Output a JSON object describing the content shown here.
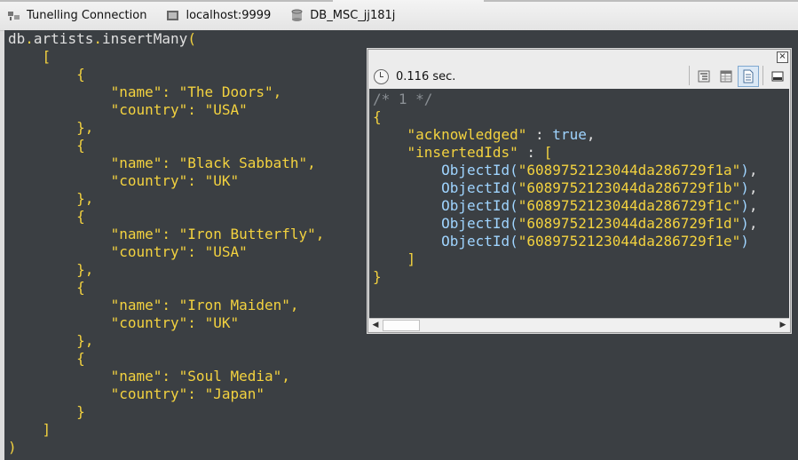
{
  "breadcrumbs": [
    {
      "label": "Tunelling Connection",
      "icon": "connection-icon"
    },
    {
      "label": "localhost:9999",
      "icon": "server-icon"
    },
    {
      "label": "DB_MSC_jj181j",
      "icon": "database-icon"
    }
  ],
  "editor": {
    "lines": [
      [
        [
          "plain",
          "db"
        ],
        [
          "punc",
          "."
        ],
        [
          "plain",
          "artists"
        ],
        [
          "punc",
          "."
        ],
        [
          "plain",
          "insertMany"
        ],
        [
          "punc",
          "("
        ]
      ],
      [
        [
          "plain",
          "    "
        ],
        [
          "punc",
          "["
        ]
      ],
      [
        [
          "plain",
          "        "
        ],
        [
          "punc",
          "{"
        ]
      ],
      [
        [
          "plain",
          "            "
        ],
        [
          "key",
          "\"name\""
        ],
        [
          "punc",
          ": "
        ],
        [
          "str",
          "\"The Doors\""
        ],
        [
          "punc",
          ","
        ]
      ],
      [
        [
          "plain",
          "            "
        ],
        [
          "key",
          "\"country\""
        ],
        [
          "punc",
          ": "
        ],
        [
          "str",
          "\"USA\""
        ]
      ],
      [
        [
          "plain",
          "        "
        ],
        [
          "punc",
          "},"
        ]
      ],
      [
        [
          "plain",
          "        "
        ],
        [
          "punc",
          "{"
        ]
      ],
      [
        [
          "plain",
          "            "
        ],
        [
          "key",
          "\"name\""
        ],
        [
          "punc",
          ": "
        ],
        [
          "str",
          "\"Black Sabbath\""
        ],
        [
          "punc",
          ","
        ]
      ],
      [
        [
          "plain",
          "            "
        ],
        [
          "key",
          "\"country\""
        ],
        [
          "punc",
          ": "
        ],
        [
          "str",
          "\"UK\""
        ]
      ],
      [
        [
          "plain",
          "        "
        ],
        [
          "punc",
          "},"
        ]
      ],
      [
        [
          "plain",
          "        "
        ],
        [
          "punc",
          "{"
        ]
      ],
      [
        [
          "plain",
          "            "
        ],
        [
          "key",
          "\"name\""
        ],
        [
          "punc",
          ": "
        ],
        [
          "str",
          "\"Iron Butterfly\""
        ],
        [
          "punc",
          ","
        ]
      ],
      [
        [
          "plain",
          "            "
        ],
        [
          "key",
          "\"country\""
        ],
        [
          "punc",
          ": "
        ],
        [
          "str",
          "\"USA\""
        ]
      ],
      [
        [
          "plain",
          "        "
        ],
        [
          "punc",
          "},"
        ]
      ],
      [
        [
          "plain",
          "        "
        ],
        [
          "punc",
          "{"
        ]
      ],
      [
        [
          "plain",
          "            "
        ],
        [
          "key",
          "\"name\""
        ],
        [
          "punc",
          ": "
        ],
        [
          "str",
          "\"Iron Maiden\""
        ],
        [
          "punc",
          ","
        ]
      ],
      [
        [
          "plain",
          "            "
        ],
        [
          "key",
          "\"country\""
        ],
        [
          "punc",
          ": "
        ],
        [
          "str",
          "\"UK\""
        ]
      ],
      [
        [
          "plain",
          "        "
        ],
        [
          "punc",
          "},"
        ]
      ],
      [
        [
          "plain",
          "        "
        ],
        [
          "punc",
          "{"
        ]
      ],
      [
        [
          "plain",
          "            "
        ],
        [
          "key",
          "\"name\""
        ],
        [
          "punc",
          ": "
        ],
        [
          "str",
          "\"Soul Media\""
        ],
        [
          "punc",
          ","
        ]
      ],
      [
        [
          "plain",
          "            "
        ],
        [
          "key",
          "\"country\""
        ],
        [
          "punc",
          ": "
        ],
        [
          "str",
          "\"Japan\""
        ]
      ],
      [
        [
          "plain",
          "        "
        ],
        [
          "punc",
          "}"
        ]
      ],
      [
        [
          "plain",
          "    "
        ],
        [
          "punc",
          "]"
        ]
      ],
      [
        [
          "punc",
          ")"
        ]
      ]
    ]
  },
  "result": {
    "time": "0.116 sec.",
    "view_buttons": [
      "tree-view-icon",
      "table-view-icon",
      "text-view-icon",
      "custom-view-icon"
    ],
    "lines": [
      [
        [
          "cm",
          "/* 1 */"
        ]
      ],
      [
        [
          "y",
          "{"
        ]
      ],
      [
        [
          "w",
          "    "
        ],
        [
          "y",
          "\"acknowledged\""
        ],
        [
          "w",
          " : "
        ],
        [
          "b",
          "true"
        ],
        [
          "w",
          ","
        ]
      ],
      [
        [
          "w",
          "    "
        ],
        [
          "y",
          "\"insertedIds\""
        ],
        [
          "w",
          " : "
        ],
        [
          "y",
          "["
        ]
      ],
      [
        [
          "w",
          "        "
        ],
        [
          "b",
          "ObjectId("
        ],
        [
          "y",
          "\"6089752123044da286729f1a\""
        ],
        [
          "b",
          ")"
        ],
        [
          "w",
          ","
        ]
      ],
      [
        [
          "w",
          "        "
        ],
        [
          "b",
          "ObjectId("
        ],
        [
          "y",
          "\"6089752123044da286729f1b\""
        ],
        [
          "b",
          ")"
        ],
        [
          "w",
          ","
        ]
      ],
      [
        [
          "w",
          "        "
        ],
        [
          "b",
          "ObjectId("
        ],
        [
          "y",
          "\"6089752123044da286729f1c\""
        ],
        [
          "b",
          ")"
        ],
        [
          "w",
          ","
        ]
      ],
      [
        [
          "w",
          "        "
        ],
        [
          "b",
          "ObjectId("
        ],
        [
          "y",
          "\"6089752123044da286729f1d\""
        ],
        [
          "b",
          ")"
        ],
        [
          "w",
          ","
        ]
      ],
      [
        [
          "w",
          "        "
        ],
        [
          "b",
          "ObjectId("
        ],
        [
          "y",
          "\"6089752123044da286729f1e\""
        ],
        [
          "b",
          ")"
        ]
      ],
      [
        [
          "w",
          "    "
        ],
        [
          "y",
          "]"
        ]
      ],
      [
        [
          "y",
          "}"
        ]
      ]
    ]
  },
  "colors": {
    "editor_bg": "#3b3f43",
    "token_yellow": "#f3d23f",
    "token_blue": "#9fd4ff"
  }
}
